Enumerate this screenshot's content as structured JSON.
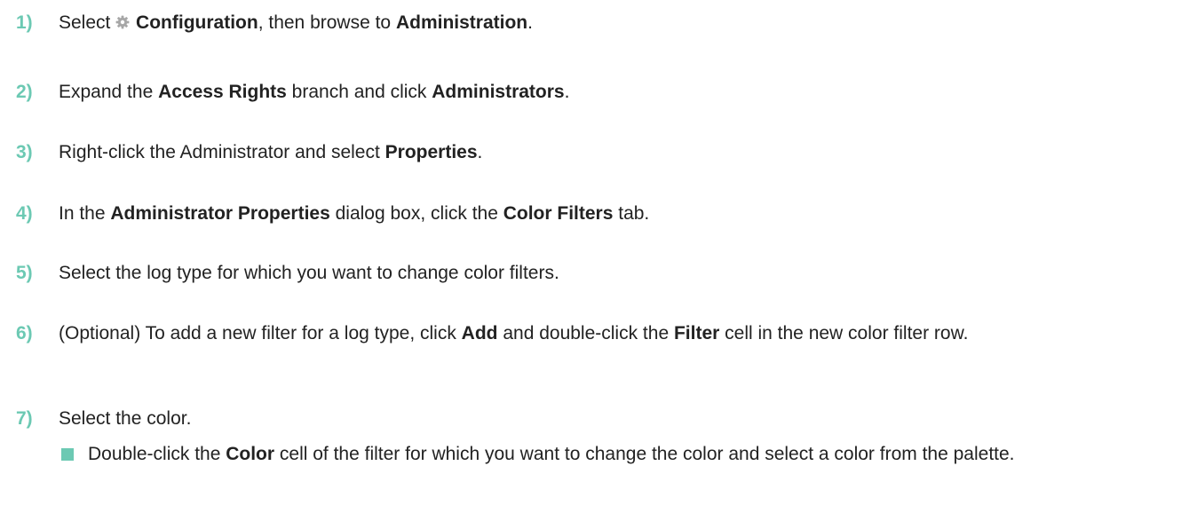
{
  "theme": {
    "accent_color": "#6cc9b3",
    "text_color": "#222222",
    "icon_color": "#a7a7a7"
  },
  "steps": [
    {
      "number": "1)",
      "parts": [
        "Select ",
        "Configuration",
        ", then browse to ",
        "Administration",
        "."
      ],
      "icon": "gear-icon"
    },
    {
      "number": "2)",
      "parts": [
        "Expand the ",
        "Access Rights",
        " branch and click ",
        "Administrators",
        "."
      ]
    },
    {
      "number": "3)",
      "parts": [
        "Right-click the Administrator and select ",
        "Properties",
        "."
      ]
    },
    {
      "number": "4)",
      "parts": [
        "In the ",
        "Administrator Properties",
        " dialog box, click the ",
        "Color Filters",
        " tab."
      ]
    },
    {
      "number": "5)",
      "parts": [
        "Select the log type for which you want to change color filters."
      ]
    },
    {
      "number": "6)",
      "parts": [
        "(Optional) To add a new filter for a log type, click ",
        "Add",
        " and double-click the ",
        "Filter",
        " cell in the new color filter row."
      ]
    },
    {
      "number": "7)",
      "parts": [
        "Select the color."
      ],
      "sub_items": [
        {
          "parts": [
            "Double-click the ",
            "Color",
            " cell of the filter for which you want to change the color and select a color from the palette."
          ]
        }
      ]
    }
  ]
}
